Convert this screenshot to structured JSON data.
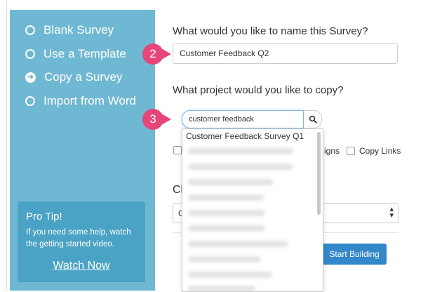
{
  "sidebar": {
    "options": [
      {
        "label": "Blank Survey",
        "state": "empty"
      },
      {
        "label": "Use a Template",
        "state": "empty"
      },
      {
        "label": "Copy a Survey",
        "state": "selected"
      },
      {
        "label": "Import from Word",
        "state": "empty"
      }
    ],
    "protip": {
      "title": "Pro Tip!",
      "text": "If you need some help, watch the getting started video.",
      "link": "Watch Now"
    }
  },
  "main": {
    "name_question": "What would you like to name this Survey?",
    "name_value": "Customer Feedback Q2",
    "project_question": "What project would you like to copy?",
    "search_value": "customer feedback",
    "dropdown_first": "Customer Feedback Survey Q1",
    "checkbox_partial_label": "igns",
    "checkbox_links_label": "Copy Links",
    "partial_heading": "Cl",
    "select_partial_value": "C",
    "start_button": "Start Building"
  },
  "badges": [
    "2",
    "3"
  ],
  "icons": {
    "search": "magnifier-icon",
    "selected_option": "arrow-right-circle-icon",
    "select_arrows": "up-down-chevron-icon"
  },
  "colors": {
    "sidebar": "#6fb8d3",
    "protip": "#4aa2c4",
    "badge": "#e8457a",
    "primary_button": "#3487c9"
  }
}
